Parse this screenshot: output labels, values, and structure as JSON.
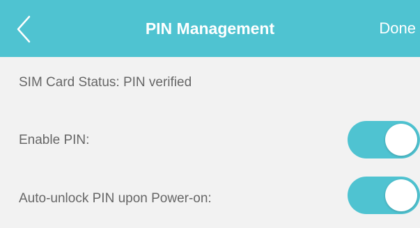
{
  "header": {
    "title": "PIN Management",
    "done_label": "Done",
    "back_icon": "chevron-left-icon",
    "background_color": "#4fc3d1"
  },
  "status": {
    "label": "SIM Card Status: PIN verified"
  },
  "settings": [
    {
      "label": "Enable PIN:",
      "enabled": true
    },
    {
      "label": "Auto-unlock PIN upon Power-on:",
      "enabled": true
    }
  ],
  "colors": {
    "accent": "#4fc3d1",
    "background": "#f2f2f2",
    "label_text": "#666666"
  }
}
